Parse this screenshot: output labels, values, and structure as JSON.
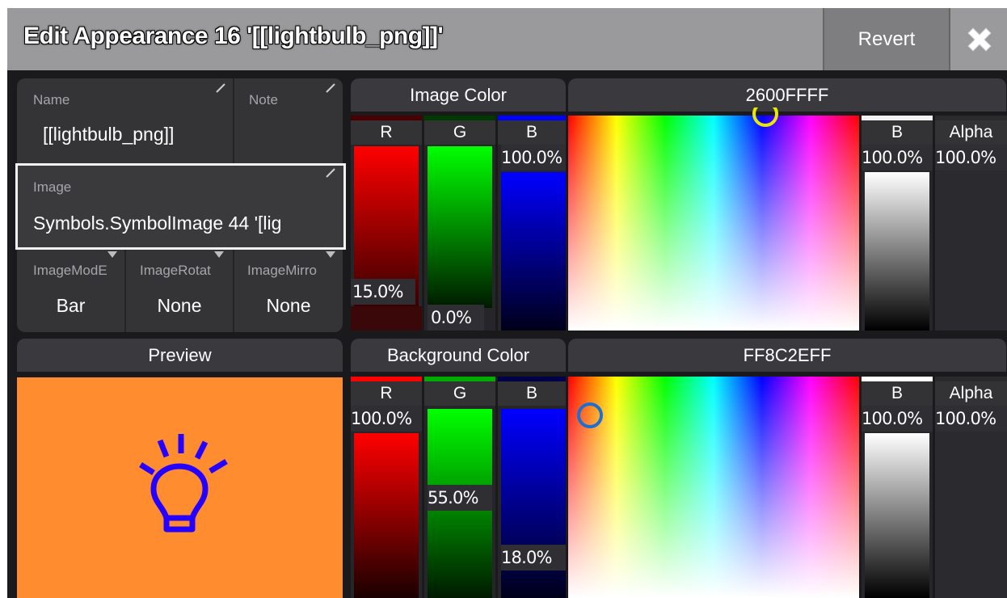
{
  "window": {
    "title": "Edit Appearance 16 '[[lightbulb_png]]'",
    "revert_label": "Revert"
  },
  "properties": {
    "name_label": "Name",
    "name_value": "[[lightbulb_png]]",
    "note_label": "Note",
    "note_value": "",
    "image_label": "Image",
    "image_value": "Symbols.SymbolImage 44 '[lig",
    "image_mode_label": "ImageModE",
    "image_mode_value": "Bar",
    "image_rotation_label": "ImageRotat",
    "image_rotation_value": "None",
    "image_mirror_label": "ImageMirro",
    "image_mirror_value": "None"
  },
  "preview": {
    "header": "Preview",
    "background_color": "#ff8c2e",
    "icon": "lightbulb-icon",
    "icon_color": "#2600ff"
  },
  "image_color": {
    "header": "Image Color",
    "hex": "2600FFFF",
    "channels": [
      {
        "label": "R",
        "value": "15.0%",
        "level": 0.15
      },
      {
        "label": "G",
        "value": "0.0%",
        "level": 0.0
      },
      {
        "label": "B",
        "value": "100.0%",
        "level": 1.0
      }
    ],
    "brightness": {
      "label": "B",
      "value": "100.0%",
      "level": 1.0
    },
    "alpha": {
      "label": "Alpha",
      "value": "100.0%",
      "level": 1.0
    },
    "marker_color": "#e8e800"
  },
  "background_color": {
    "header": "Background Color",
    "hex": "FF8C2EFF",
    "channels": [
      {
        "label": "R",
        "value": "100.0%",
        "level": 1.0
      },
      {
        "label": "G",
        "value": "55.0%",
        "level": 0.55
      },
      {
        "label": "B",
        "value": "18.0%",
        "level": 0.18
      }
    ],
    "brightness": {
      "label": "B",
      "value": "100.0%",
      "level": 1.0
    },
    "alpha": {
      "label": "Alpha",
      "value": "100.0%",
      "level": 1.0
    },
    "marker_color": "#1e6fd0"
  }
}
